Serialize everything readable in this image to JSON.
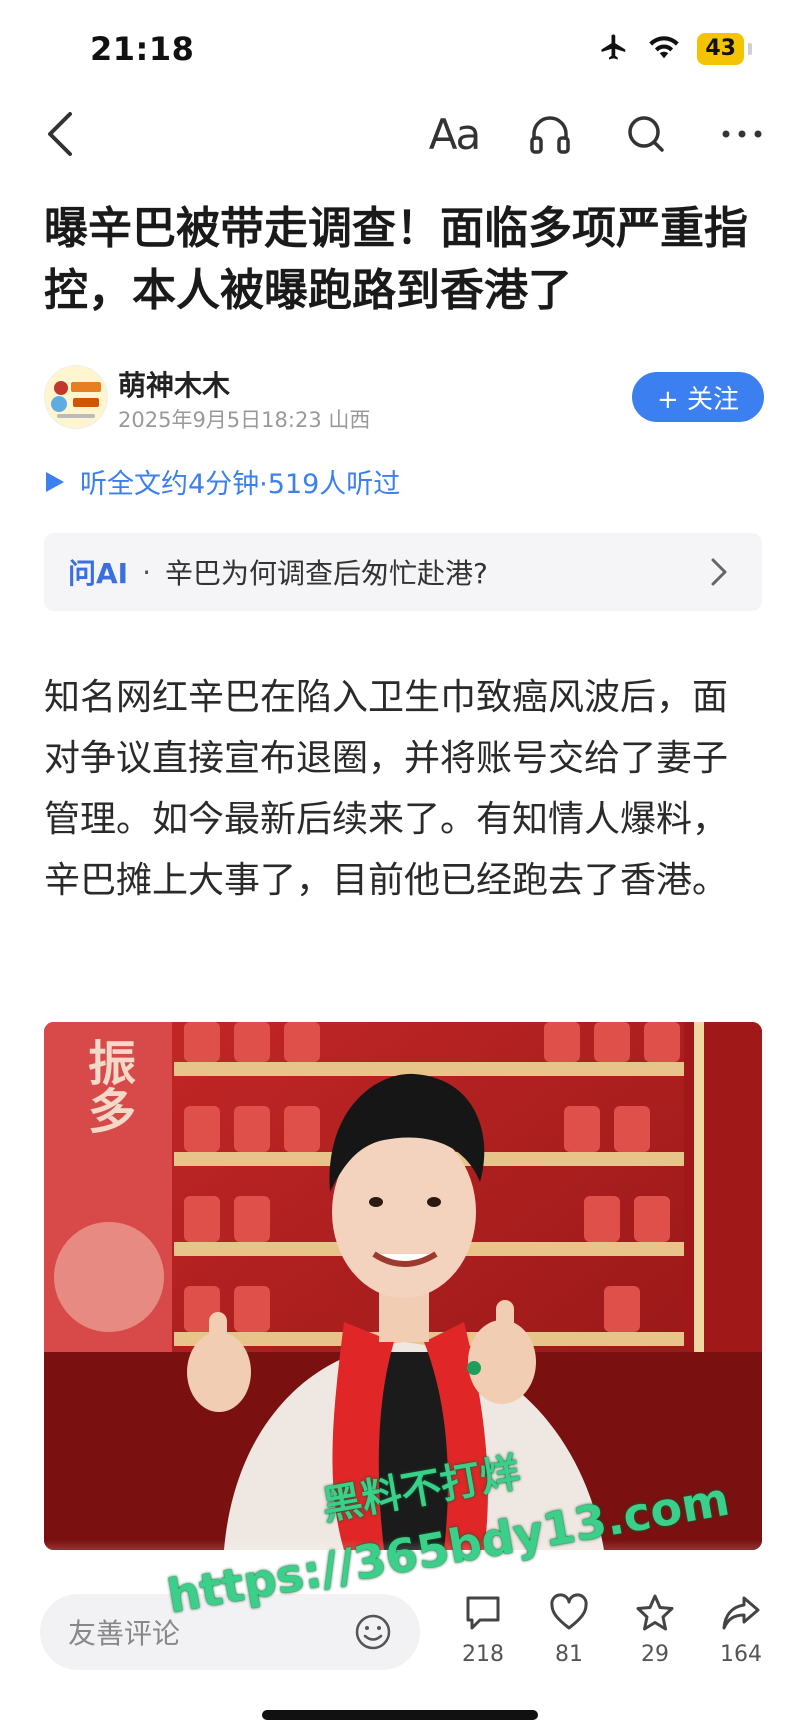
{
  "status_bar": {
    "time": "21:18",
    "battery": "43"
  },
  "nav": {
    "font_button": "Aa"
  },
  "article": {
    "title": "曝辛巴被带走调查！面临多项严重指控，本人被曝跑路到香港了",
    "author": {
      "name": "萌神木木",
      "meta": "2025年9月5日18:23 山西",
      "follow_label": "+ 关注"
    },
    "listen": "听全文约4分钟·519人听过",
    "ask_ai": {
      "label": "问AI",
      "dot": "·",
      "question": "辛巴为何调查后匆忙赴港?"
    },
    "body": "知名网红辛巴在陷入卫生巾致癌风波后，面对争议直接宣布退圈，并将账号交给了妻子管理。如今最新后续来了。有知情人爆料，辛巴摊上大事了，目前他已经跑去了香港。",
    "photo_sign_text": "振多"
  },
  "bottom_bar": {
    "comment_placeholder": "友善评论",
    "comments": "218",
    "likes": "81",
    "favorites": "29",
    "shares": "164"
  },
  "watermark": {
    "line1": "黑料不打烊",
    "line2": "https://365bdy13.com"
  },
  "colors": {
    "accent": "#3b7ff0",
    "battery": "#f5c400",
    "watermark": "#3bd08a"
  }
}
